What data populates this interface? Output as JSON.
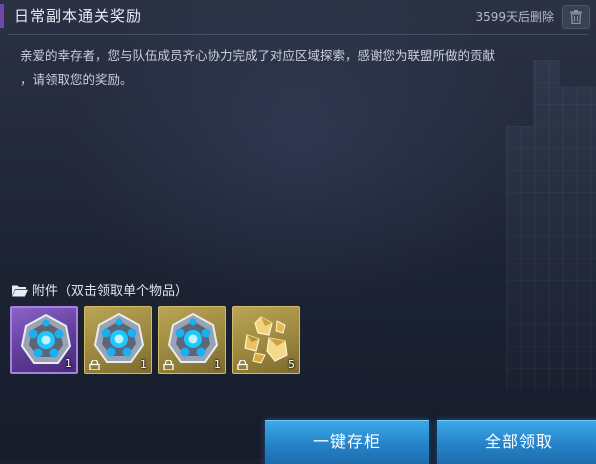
{
  "mail": {
    "title": "日常副本通关奖励",
    "expire_text": "3599天后删除",
    "body_line1": "亲爱的幸存者，您与队伍成员齐心协力完成了对应区域探索，感谢您为联盟所做的贡献",
    "body_line2": "，请领取您的奖励。"
  },
  "attachments": {
    "header": "附件（双击领取单个物品）",
    "items": [
      {
        "icon": "blue-core-crystal",
        "rarity": "purple",
        "quantity": "1",
        "bound": false
      },
      {
        "icon": "blue-core-crystal",
        "rarity": "gold",
        "quantity": "1",
        "bound": true
      },
      {
        "icon": "blue-core-crystal",
        "rarity": "gold",
        "quantity": "1",
        "bound": true
      },
      {
        "icon": "gold-ore-shards",
        "rarity": "gold",
        "quantity": "5",
        "bound": true
      }
    ]
  },
  "buttons": {
    "store_all": "一键存柜",
    "claim_all": "全部领取"
  },
  "colors": {
    "title_accent": "#6e4aa8",
    "button_blue": "#2683c9",
    "rarity_purple": "#5f3d99",
    "rarity_gold": "#9b873e"
  }
}
